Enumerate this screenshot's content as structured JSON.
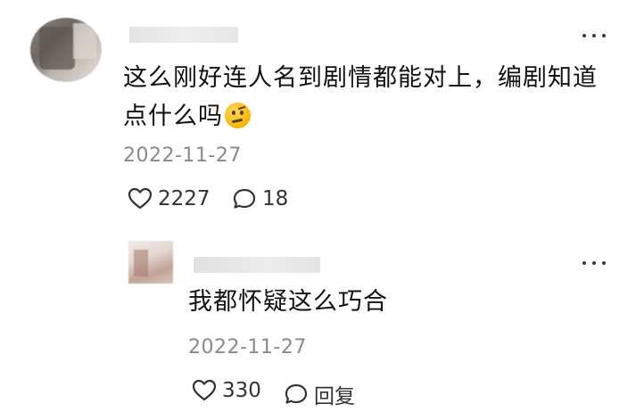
{
  "comment": {
    "text": "这么刚好连人名到剧情都能对上，编剧知道点什么吗",
    "emoji": "thinking-face-emoji",
    "date": "2022-11-27",
    "like_count": "2227",
    "reply_count": "18"
  },
  "reply": {
    "text": "我都怀疑这么巧合",
    "date": "2022-11-27",
    "like_count": "330",
    "reply_label": "回复"
  },
  "icons": {
    "like": "heart-outline-icon",
    "comment": "speech-bubble-icon",
    "more": "more-dots-icon"
  },
  "colors": {
    "text": "#111111",
    "meta": "#8a8a8a",
    "icon": "#333333"
  }
}
